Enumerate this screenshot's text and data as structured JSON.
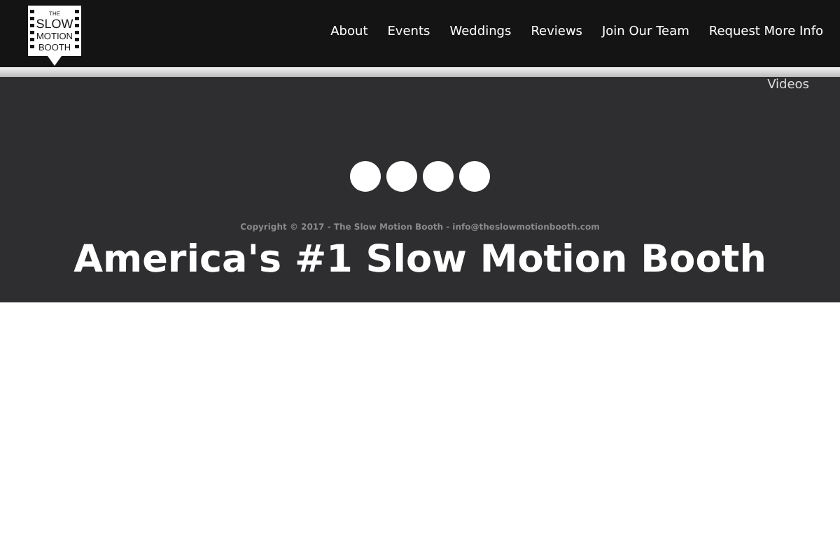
{
  "logo": {
    "lines": [
      "THE",
      "SLOW",
      "MOTION",
      "BOOTH"
    ]
  },
  "nav": {
    "items": [
      "About",
      "Events",
      "Weddings",
      "Reviews",
      "Join Our Team",
      "Request More Info"
    ],
    "overflow_item": "Videos"
  },
  "hero": {
    "copyright": "Copyright © 2017 - The Slow Motion Booth - info@theslowmotionbooth.com",
    "headline": "America's #1 Slow Motion Booth",
    "social_icon_count_dots": [
      {
        "kind": "circle"
      },
      {
        "kind": "circle"
      },
      {
        "kind": "circle"
      },
      {
        "kind": "circle"
      }
    ]
  }
}
